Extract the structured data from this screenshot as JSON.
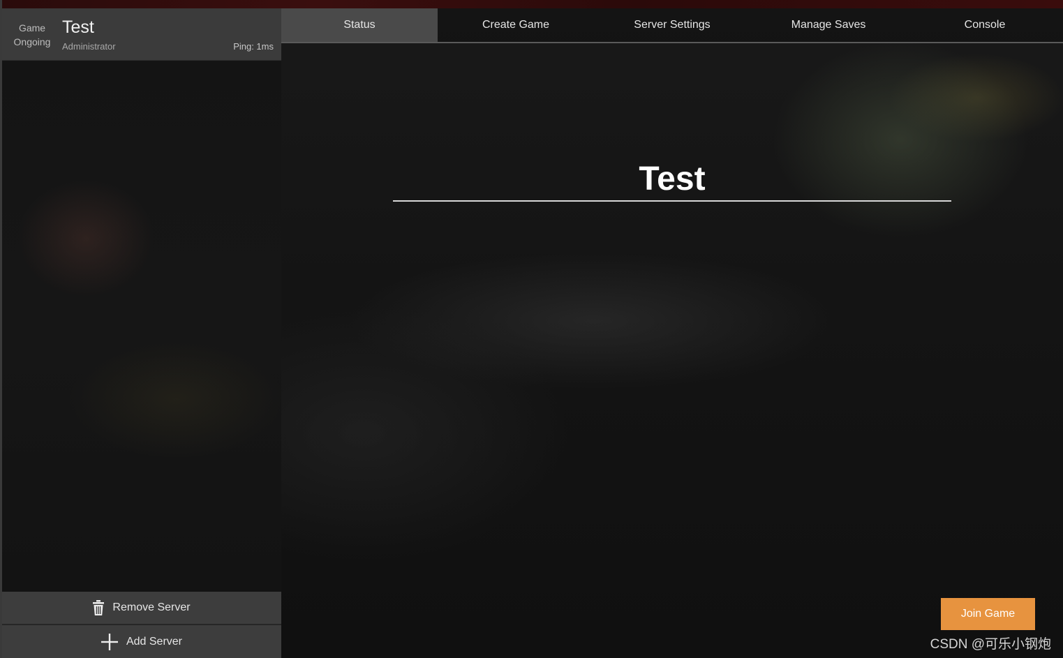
{
  "colors": {
    "active_tab": "#4a4a4a",
    "panel": "#3b3b3b",
    "join_button": "#e7933f"
  },
  "server": {
    "state_line1": "Game",
    "state_line2": "Ongoing",
    "name": "Test",
    "role": "Administrator",
    "ping": "Ping: 1ms"
  },
  "sidebar": {
    "remove_label": "Remove Server",
    "remove_icon": "trash-icon",
    "add_label": "Add Server",
    "add_icon": "plus-icon"
  },
  "tabs": [
    {
      "label": "Status",
      "active": true
    },
    {
      "label": "Create Game",
      "active": false
    },
    {
      "label": "Server Settings",
      "active": false
    },
    {
      "label": "Manage Saves",
      "active": false
    },
    {
      "label": "Console",
      "active": false
    }
  ],
  "main": {
    "title": "Test",
    "join_label": "Join Game"
  },
  "watermark": "CSDN @可乐小钢炮"
}
